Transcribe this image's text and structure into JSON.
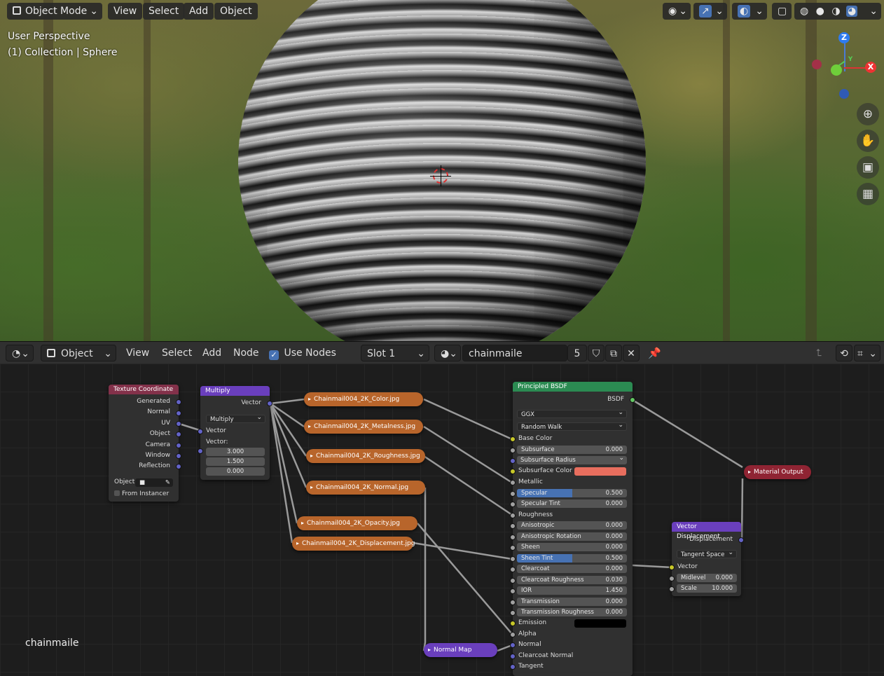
{
  "viewport": {
    "mode_label": "Object Mode",
    "menus": [
      "View",
      "Select",
      "Add",
      "Object"
    ],
    "overlay_line1": "User Perspective",
    "overlay_line2": "(1) Collection | Sphere",
    "axis_labels": {
      "z": "Z",
      "y": "Y",
      "x": "X"
    },
    "nav_icons": [
      "zoom-icon",
      "hand-icon",
      "camera-icon",
      "grid-icon"
    ]
  },
  "editor": {
    "editor_type_icon": "node-editor-icon",
    "object_label": "Object",
    "menus": [
      "View",
      "Select",
      "Add",
      "Node"
    ],
    "use_nodes_label": "Use Nodes",
    "use_nodes_checked": true,
    "slot_label": "Slot 1",
    "material_name": "chainmaile",
    "user_count": "5",
    "footer_label": "chainmaile"
  },
  "nodes": {
    "texcoord": {
      "title": "Texture Coordinate",
      "outputs": [
        "Generated",
        "Normal",
        "UV",
        "Object",
        "Camera",
        "Window",
        "Reflection"
      ],
      "object_label": "Object:",
      "from_instancer": "From Instancer"
    },
    "multiply": {
      "title": "Multiply",
      "out_label": "Vector",
      "operation": "Multiply",
      "in_label": "Vector",
      "vec_label": "Vector:",
      "values": [
        "3.000",
        "1.500",
        "0.000"
      ]
    },
    "textures": [
      "Chainmail004_2K_Color.jpg",
      "Chainmail004_2K_Metalness.jpg",
      "Chainmail004_2K_Roughness.jpg",
      "Chainmail004_2K_Normal.jpg",
      "Chainmail004_2K_Opacity.jpg",
      "Chainmail004_2K_Displacement.jpg"
    ],
    "normal_map": "Normal Map",
    "bsdf": {
      "title": "Principled BSDF",
      "output": "BSDF",
      "distribution": "GGX",
      "subsurface_method": "Random Walk",
      "base_color": "Base Color",
      "subsurface": {
        "label": "Subsurface",
        "value": "0.000"
      },
      "subsurface_radius": "Subsurface Radius",
      "subsurface_color": {
        "label": "Subsurface Color",
        "swatch": "#e86e5e"
      },
      "metallic": "Metallic",
      "specular": {
        "label": "Specular",
        "value": "0.500",
        "fill": 0.5
      },
      "specular_tint": {
        "label": "Specular Tint",
        "value": "0.000"
      },
      "roughness": "Roughness",
      "anisotropic": {
        "label": "Anisotropic",
        "value": "0.000"
      },
      "anisotropic_rotation": {
        "label": "Anisotropic Rotation",
        "value": "0.000"
      },
      "sheen": {
        "label": "Sheen",
        "value": "0.000"
      },
      "sheen_tint": {
        "label": "Sheen Tint",
        "value": "0.500",
        "fill": 0.5
      },
      "clearcoat": {
        "label": "Clearcoat",
        "value": "0.000"
      },
      "clearcoat_roughness": {
        "label": "Clearcoat Roughness",
        "value": "0.030"
      },
      "ior": {
        "label": "IOR",
        "value": "1.450"
      },
      "transmission": {
        "label": "Transmission",
        "value": "0.000"
      },
      "transmission_roughness": {
        "label": "Transmission Roughness",
        "value": "0.000"
      },
      "emission": {
        "label": "Emission",
        "swatch": "#000000"
      },
      "alpha": "Alpha",
      "normal": "Normal",
      "clearcoat_normal": "Clearcoat Normal",
      "tangent": "Tangent"
    },
    "material_output": "Material Output",
    "vector_displacement": {
      "title": "Vector Displacement",
      "output": "Displacement",
      "space": "Tangent Space",
      "vector": "Vector",
      "midlevel": {
        "label": "Midlevel",
        "value": "0.000"
      },
      "scale": {
        "label": "Scale",
        "value": "10.000"
      }
    }
  },
  "colors": {
    "texcoord_header": "#83314a",
    "vector_header": "#6a3fbd",
    "shader_header": "#2b8b52",
    "output_header": "#8f2433",
    "texture_node": "#b8652b",
    "field_fill": "#4772b3"
  }
}
